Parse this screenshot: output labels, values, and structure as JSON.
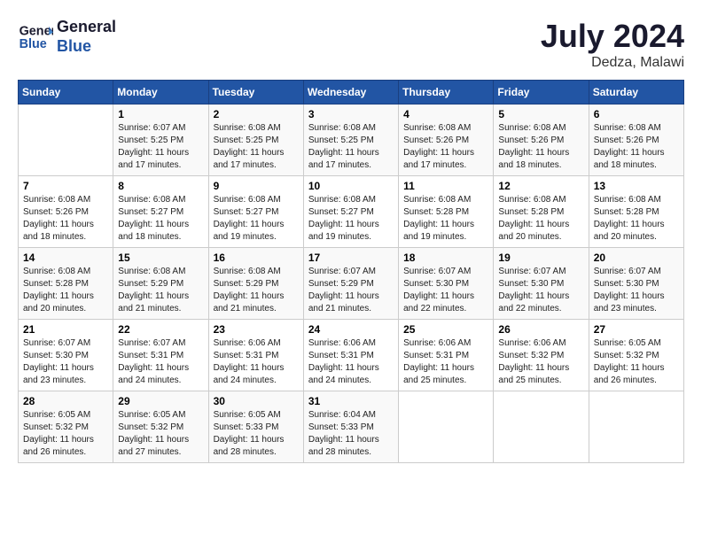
{
  "header": {
    "logo_line1": "General",
    "logo_line2": "Blue",
    "month_title": "July 2024",
    "location": "Dedza, Malawi"
  },
  "days_of_week": [
    "Sunday",
    "Monday",
    "Tuesday",
    "Wednesday",
    "Thursday",
    "Friday",
    "Saturday"
  ],
  "weeks": [
    [
      {
        "day": "",
        "info": ""
      },
      {
        "day": "1",
        "info": "Sunrise: 6:07 AM\nSunset: 5:25 PM\nDaylight: 11 hours\nand 17 minutes."
      },
      {
        "day": "2",
        "info": "Sunrise: 6:08 AM\nSunset: 5:25 PM\nDaylight: 11 hours\nand 17 minutes."
      },
      {
        "day": "3",
        "info": "Sunrise: 6:08 AM\nSunset: 5:25 PM\nDaylight: 11 hours\nand 17 minutes."
      },
      {
        "day": "4",
        "info": "Sunrise: 6:08 AM\nSunset: 5:26 PM\nDaylight: 11 hours\nand 17 minutes."
      },
      {
        "day": "5",
        "info": "Sunrise: 6:08 AM\nSunset: 5:26 PM\nDaylight: 11 hours\nand 18 minutes."
      },
      {
        "day": "6",
        "info": "Sunrise: 6:08 AM\nSunset: 5:26 PM\nDaylight: 11 hours\nand 18 minutes."
      }
    ],
    [
      {
        "day": "7",
        "info": "Sunrise: 6:08 AM\nSunset: 5:26 PM\nDaylight: 11 hours\nand 18 minutes."
      },
      {
        "day": "8",
        "info": "Sunrise: 6:08 AM\nSunset: 5:27 PM\nDaylight: 11 hours\nand 18 minutes."
      },
      {
        "day": "9",
        "info": "Sunrise: 6:08 AM\nSunset: 5:27 PM\nDaylight: 11 hours\nand 19 minutes."
      },
      {
        "day": "10",
        "info": "Sunrise: 6:08 AM\nSunset: 5:27 PM\nDaylight: 11 hours\nand 19 minutes."
      },
      {
        "day": "11",
        "info": "Sunrise: 6:08 AM\nSunset: 5:28 PM\nDaylight: 11 hours\nand 19 minutes."
      },
      {
        "day": "12",
        "info": "Sunrise: 6:08 AM\nSunset: 5:28 PM\nDaylight: 11 hours\nand 20 minutes."
      },
      {
        "day": "13",
        "info": "Sunrise: 6:08 AM\nSunset: 5:28 PM\nDaylight: 11 hours\nand 20 minutes."
      }
    ],
    [
      {
        "day": "14",
        "info": "Sunrise: 6:08 AM\nSunset: 5:28 PM\nDaylight: 11 hours\nand 20 minutes."
      },
      {
        "day": "15",
        "info": "Sunrise: 6:08 AM\nSunset: 5:29 PM\nDaylight: 11 hours\nand 21 minutes."
      },
      {
        "day": "16",
        "info": "Sunrise: 6:08 AM\nSunset: 5:29 PM\nDaylight: 11 hours\nand 21 minutes."
      },
      {
        "day": "17",
        "info": "Sunrise: 6:07 AM\nSunset: 5:29 PM\nDaylight: 11 hours\nand 21 minutes."
      },
      {
        "day": "18",
        "info": "Sunrise: 6:07 AM\nSunset: 5:30 PM\nDaylight: 11 hours\nand 22 minutes."
      },
      {
        "day": "19",
        "info": "Sunrise: 6:07 AM\nSunset: 5:30 PM\nDaylight: 11 hours\nand 22 minutes."
      },
      {
        "day": "20",
        "info": "Sunrise: 6:07 AM\nSunset: 5:30 PM\nDaylight: 11 hours\nand 23 minutes."
      }
    ],
    [
      {
        "day": "21",
        "info": "Sunrise: 6:07 AM\nSunset: 5:30 PM\nDaylight: 11 hours\nand 23 minutes."
      },
      {
        "day": "22",
        "info": "Sunrise: 6:07 AM\nSunset: 5:31 PM\nDaylight: 11 hours\nand 24 minutes."
      },
      {
        "day": "23",
        "info": "Sunrise: 6:06 AM\nSunset: 5:31 PM\nDaylight: 11 hours\nand 24 minutes."
      },
      {
        "day": "24",
        "info": "Sunrise: 6:06 AM\nSunset: 5:31 PM\nDaylight: 11 hours\nand 24 minutes."
      },
      {
        "day": "25",
        "info": "Sunrise: 6:06 AM\nSunset: 5:31 PM\nDaylight: 11 hours\nand 25 minutes."
      },
      {
        "day": "26",
        "info": "Sunrise: 6:06 AM\nSunset: 5:32 PM\nDaylight: 11 hours\nand 25 minutes."
      },
      {
        "day": "27",
        "info": "Sunrise: 6:05 AM\nSunset: 5:32 PM\nDaylight: 11 hours\nand 26 minutes."
      }
    ],
    [
      {
        "day": "28",
        "info": "Sunrise: 6:05 AM\nSunset: 5:32 PM\nDaylight: 11 hours\nand 26 minutes."
      },
      {
        "day": "29",
        "info": "Sunrise: 6:05 AM\nSunset: 5:32 PM\nDaylight: 11 hours\nand 27 minutes."
      },
      {
        "day": "30",
        "info": "Sunrise: 6:05 AM\nSunset: 5:33 PM\nDaylight: 11 hours\nand 28 minutes."
      },
      {
        "day": "31",
        "info": "Sunrise: 6:04 AM\nSunset: 5:33 PM\nDaylight: 11 hours\nand 28 minutes."
      },
      {
        "day": "",
        "info": ""
      },
      {
        "day": "",
        "info": ""
      },
      {
        "day": "",
        "info": ""
      }
    ]
  ]
}
